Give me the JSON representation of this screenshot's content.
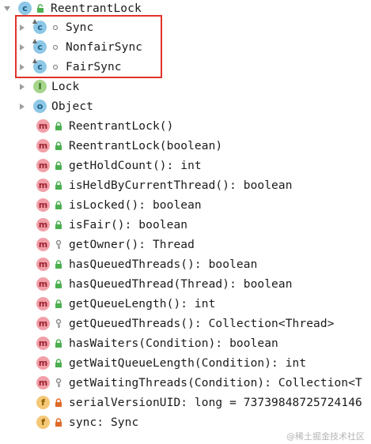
{
  "root": {
    "label": "ReentrantLock",
    "icon": "class-icon"
  },
  "nested": [
    {
      "label": "Sync",
      "icon": "class-icon"
    },
    {
      "label": "NonfairSync",
      "icon": "class-icon"
    },
    {
      "label": "FairSync",
      "icon": "class-icon"
    }
  ],
  "supers": [
    {
      "label": "Lock",
      "icon": "interface-icon"
    },
    {
      "label": "Object",
      "icon": "class-icon"
    }
  ],
  "members": [
    {
      "label": "ReentrantLock()",
      "kind": "m",
      "access": "public"
    },
    {
      "label": "ReentrantLock(boolean)",
      "kind": "m",
      "access": "public"
    },
    {
      "label": "getHoldCount(): int",
      "kind": "m",
      "access": "public"
    },
    {
      "label": "isHeldByCurrentThread(): boolean",
      "kind": "m",
      "access": "public"
    },
    {
      "label": "isLocked(): boolean",
      "kind": "m",
      "access": "public"
    },
    {
      "label": "isFair(): boolean",
      "kind": "m",
      "access": "public"
    },
    {
      "label": "getOwner(): Thread",
      "kind": "m",
      "access": "protected"
    },
    {
      "label": "hasQueuedThreads(): boolean",
      "kind": "m",
      "access": "public"
    },
    {
      "label": "hasQueuedThread(Thread): boolean",
      "kind": "m",
      "access": "public"
    },
    {
      "label": "getQueueLength(): int",
      "kind": "m",
      "access": "public"
    },
    {
      "label": "getQueuedThreads(): Collection<Thread>",
      "kind": "m",
      "access": "protected"
    },
    {
      "label": "hasWaiters(Condition): boolean",
      "kind": "m",
      "access": "public"
    },
    {
      "label": "getWaitQueueLength(Condition): int",
      "kind": "m",
      "access": "public"
    },
    {
      "label": "getWaitingThreads(Condition): Collection<T",
      "kind": "m",
      "access": "protected"
    },
    {
      "label": "serialVersionUID: long = 73739848725724146",
      "kind": "f",
      "access": "private"
    },
    {
      "label": "sync: Sync",
      "kind": "f",
      "access": "private"
    }
  ],
  "watermark": "@稀土掘金技术社区",
  "colors": {
    "selection_border": "#e0332b",
    "public_lock": "#4caf50",
    "private_lock": "#e06a2a"
  }
}
